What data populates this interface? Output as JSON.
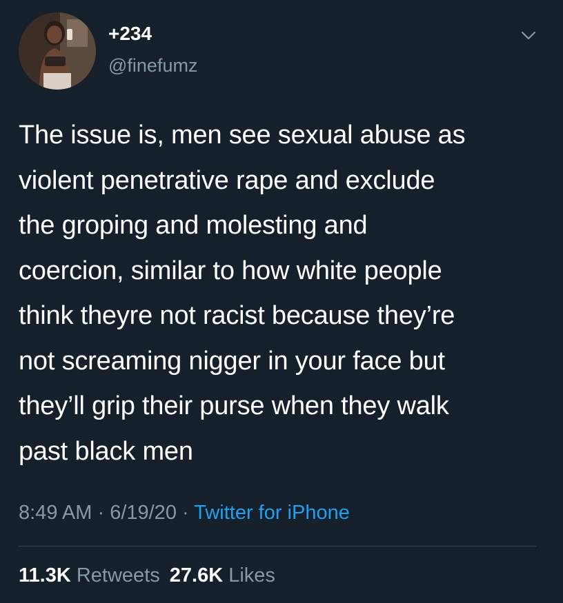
{
  "tweet": {
    "author": {
      "display_name": "+234",
      "handle": "@finefumz"
    },
    "text": "The issue is, men see sexual abuse as\nviolent penetrative rape and exclude\nthe groping and molesting and\ncoercion, similar to how white people\nthink theyre not racist because they’re\nnot screaming nigger in your face but\nthey’ll grip their purse when they walk\npast black men",
    "time": "8:49 AM",
    "date": "6/19/20",
    "separator": " · ",
    "source": "Twitter for iPhone",
    "retweets": {
      "count": "11.3K",
      "label": "Retweets"
    },
    "likes": {
      "count": "27.6K",
      "label": "Likes"
    }
  },
  "icons": {
    "avatar": "profile-photo",
    "menu": "chevron-down-icon"
  },
  "colors": {
    "background": "#15202b",
    "text_primary": "#ffffff",
    "text_secondary": "#8899a6",
    "link": "#1da1f2",
    "divider": "#38444d"
  }
}
